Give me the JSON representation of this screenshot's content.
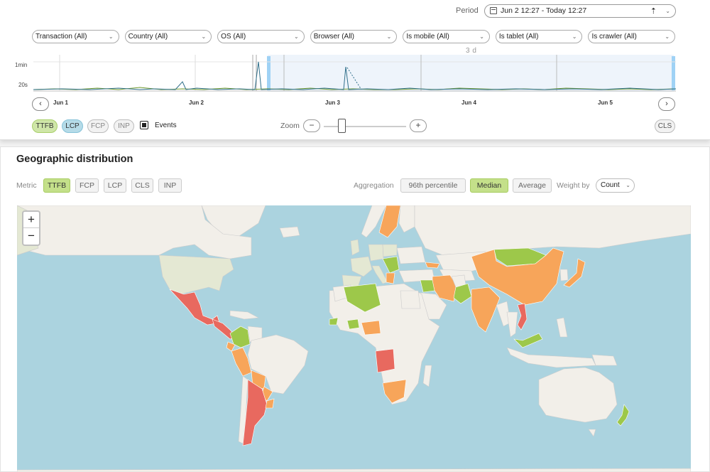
{
  "period": {
    "label": "Period",
    "value": "Jun 2 12:27 - Today 12:27"
  },
  "filters": [
    "Transaction (All)",
    "Country (All)",
    "OS (All)",
    "Browser (All)",
    "Is mobile (All)",
    "Is tablet (All)",
    "Is crawler (All)"
  ],
  "timeline": {
    "selection_label": "3 d",
    "y_ticks": [
      "1min",
      "20s"
    ],
    "x_ticks": [
      "Jun 1",
      "Jun 2",
      "Jun 3",
      "Jun 4",
      "Jun 5"
    ],
    "metric_toggles": [
      "TTFB",
      "LCP",
      "FCP",
      "INP"
    ],
    "events_label": "Events",
    "zoom_label": "Zoom",
    "zoom_out": "−",
    "zoom_in": "+",
    "cls_toggle": "CLS",
    "prev": "‹",
    "next": "›"
  },
  "geo": {
    "title": "Geographic distribution",
    "metric_label": "Metric",
    "metrics": [
      "TTFB",
      "FCP",
      "LCP",
      "CLS",
      "INP"
    ],
    "selected_metric": "TTFB",
    "aggregation_label": "Aggregation",
    "aggregations": [
      "96th percentile",
      "Median",
      "Average"
    ],
    "selected_aggregation": "Median",
    "weight_label": "Weight by",
    "weight_value": "Count",
    "map_zoom_in": "+",
    "map_zoom_out": "−"
  },
  "colors": {
    "good": "#9dc84a",
    "needs_improvement": "#f7a55a",
    "poor": "#e8695f",
    "no_data": "#f2efe9",
    "water": "#abd3df",
    "series_ttfb": "#6f9a2e",
    "series_lcp": "#2f6f8a"
  }
}
